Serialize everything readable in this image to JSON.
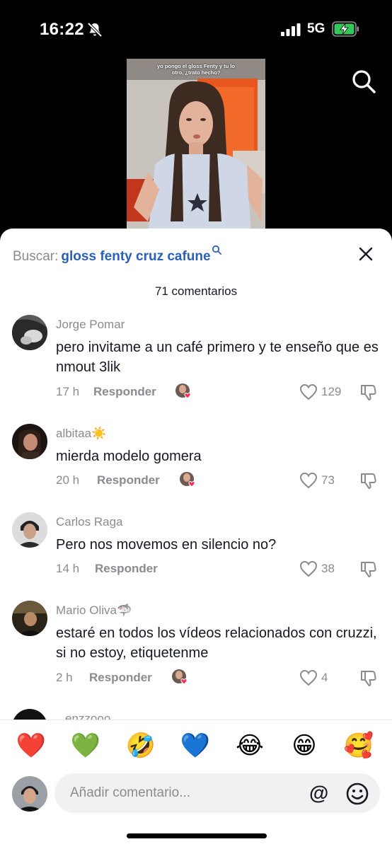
{
  "status_bar": {
    "time": "16:22",
    "network": "5G",
    "icons": [
      "bell-slash-icon",
      "signal-icon",
      "battery-charging-icon"
    ]
  },
  "video": {
    "caption": "yo pongo el gloss Fenty y tu lo otro, ¿trato hecho?"
  },
  "search": {
    "prefix": "Buscar:",
    "query": "gloss fenty cruz cafune"
  },
  "comments_header": {
    "count_label": "71 comentarios"
  },
  "comments": [
    {
      "user": "Jorge Pomar",
      "user_emoji": "",
      "text": "pero invitame a un café primero y te enseño que es nmout 3lik",
      "time": "17 h",
      "reply": "Responder",
      "likes": "129"
    },
    {
      "user": "albitaa",
      "user_emoji": "☀️",
      "text": "mierda modelo gomera",
      "time": "20 h",
      "reply": "Responder",
      "likes": "73"
    },
    {
      "user": "Carlos Raga",
      "user_emoji": "",
      "text": "Pero nos movemos en silencio no?",
      "time": "14 h",
      "reply": "Responder",
      "likes": "38"
    },
    {
      "user": "Mario Oliva",
      "user_emoji": "🦈",
      "text": "estaré en todos los vídeos relacionados con cruzzi, si no estoy, etiquetenme",
      "time": "2 h",
      "reply": "Responder",
      "likes": "4"
    }
  ],
  "partial_comment": {
    "user": "enzzooo"
  },
  "emoji_bar": [
    "❤️",
    "💚",
    "🤣",
    "💙",
    "😂",
    "😁",
    "🥰"
  ],
  "composer": {
    "placeholder": "Añadir comentario...",
    "mention": "@"
  },
  "colors": {
    "accent": "#2a5fb8",
    "text": "#161823",
    "muted": "#8a8b91",
    "like_red": "#fe2c55",
    "battery_green": "#34c759"
  }
}
